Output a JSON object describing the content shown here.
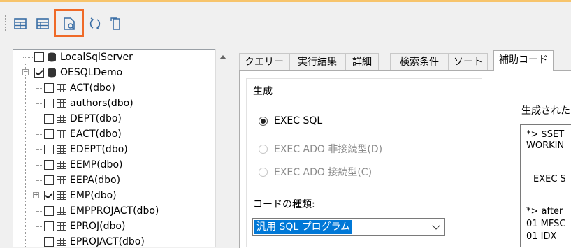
{
  "toolbar": {
    "buttons": [
      {
        "icon": "add-connection-icon"
      },
      {
        "icon": "remove-connection-icon"
      },
      {
        "icon": "generate-code-icon",
        "highlighted": true,
        "highlight_color": "#ef6a28"
      },
      {
        "icon": "refresh-icon"
      },
      {
        "icon": "copy-icon"
      }
    ]
  },
  "tree": {
    "items": [
      {
        "label": "LocalSqlServer",
        "type": "database",
        "checked": false
      },
      {
        "label": "OESQLDemo",
        "type": "database",
        "checked": true,
        "expanded": true
      },
      {
        "label": "ACT(dbo)",
        "type": "table",
        "checked": false
      },
      {
        "label": "authors(dbo)",
        "type": "table",
        "checked": false
      },
      {
        "label": "DEPT(dbo)",
        "type": "table",
        "checked": false
      },
      {
        "label": "EACT(dbo)",
        "type": "table",
        "checked": false
      },
      {
        "label": "EDEPT(dbo)",
        "type": "table",
        "checked": false
      },
      {
        "label": "EEMP(dbo)",
        "type": "table",
        "checked": false
      },
      {
        "label": "EEPA(dbo)",
        "type": "table",
        "checked": false
      },
      {
        "label": "EMP(dbo)",
        "type": "table",
        "checked": true,
        "expandable": true
      },
      {
        "label": "EMPPROJACT(dbo)",
        "type": "table",
        "checked": false
      },
      {
        "label": "EPROJ(dbo)",
        "type": "table",
        "checked": false
      },
      {
        "label": "EPROJACT(dbo)",
        "type": "table",
        "checked": false
      }
    ]
  },
  "tabs": [
    {
      "label": "クエリー"
    },
    {
      "label": "実行結果"
    },
    {
      "label": "詳細"
    },
    {
      "label": "検索条件"
    },
    {
      "label": "ソート"
    },
    {
      "label": "補助コード",
      "active": true
    }
  ],
  "generate": {
    "group_title": "生成",
    "options": [
      {
        "label": "EXEC SQL",
        "selected": true,
        "enabled": true
      },
      {
        "label": "EXEC ADO 非接続型(D)",
        "selected": false,
        "enabled": false
      },
      {
        "label": "EXEC ADO 接続型(C)",
        "selected": false,
        "enabled": false
      }
    ],
    "code_kind_label": "コードの種類:",
    "code_kind_value": "汎用 SQL プログラム"
  },
  "generated": {
    "label": "生成された",
    "lines": [
      "*> $SET",
      "WORKIN",
      "",
      "  EXEC S",
      "",
      "*> after",
      "01 MFSC",
      "01 IDX"
    ]
  }
}
